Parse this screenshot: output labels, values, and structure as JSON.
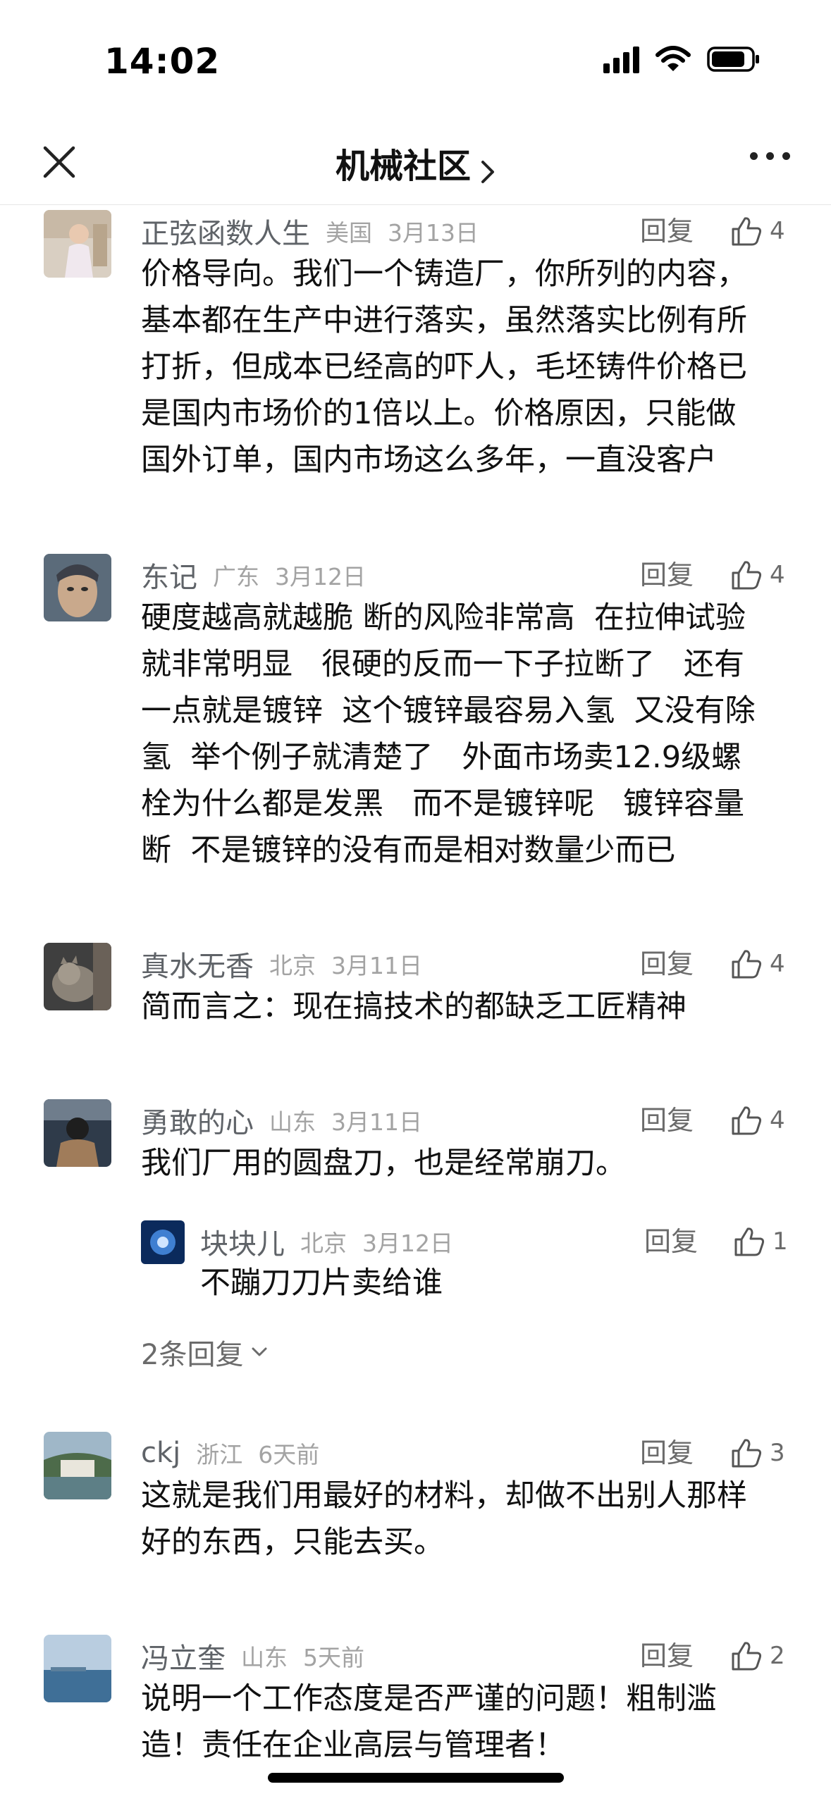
{
  "status_bar": {
    "time": "14:02"
  },
  "nav": {
    "title": "机械社区"
  },
  "labels": {
    "reply": "回复"
  },
  "comments": [
    {
      "name": "正弦函数人生",
      "location": "美国",
      "date": "3月13日",
      "likes": "4",
      "lines": [
        "价格导向。我们一个铸造厂，你所列的内容，",
        "基本都在生产中进行落实，虽然落实比例有所",
        "打折，但成本已经高的吓人，毛坯铸件价格已",
        "是国内市场价的1倍以上。价格原因，只能做",
        "国外订单，国内市场这么多年，一直没客户"
      ]
    },
    {
      "name": "东记",
      "location": "广东",
      "date": "3月12日",
      "likes": "4",
      "lines": [
        "硬度越高就越脆 断的风险非常高  在拉伸试验",
        "就非常明显   很硬的反而一下子拉断了   还有",
        "一点就是镀锌  这个镀锌最容易入氢  又没有除",
        "氢  举个例子就清楚了   外面市场卖12.9级螺",
        "栓为什么都是发黑   而不是镀锌呢   镀锌容量",
        "断  不是镀锌的没有而是相对数量少而已"
      ]
    },
    {
      "name": "真水无香",
      "location": "北京",
      "date": "3月11日",
      "likes": "4",
      "lines": [
        "简而言之：现在搞技术的都缺乏工匠精神"
      ]
    },
    {
      "name": "勇敢的心",
      "location": "山东",
      "date": "3月11日",
      "likes": "4",
      "lines": [
        "我们厂用的圆盘刀，也是经常崩刀。"
      ],
      "sub_reply": {
        "name": "块块儿",
        "location": "北京",
        "date": "3月12日",
        "likes": "1",
        "text": "不蹦刀刀片卖给谁"
      },
      "more_replies": "2条回复"
    },
    {
      "name": "ckj",
      "location": "浙江",
      "date": "6天前",
      "likes": "3",
      "lines": [
        "这就是我们用最好的材料，却做不出别人那样",
        "好的东西，只能去买。"
      ]
    },
    {
      "name": "冯立奎",
      "location": "山东",
      "date": "5天前",
      "likes": "2",
      "lines": [
        "说明一个工作态度是否严谨的问题！粗制滥",
        "造！责任在企业高层与管理者！"
      ]
    }
  ]
}
